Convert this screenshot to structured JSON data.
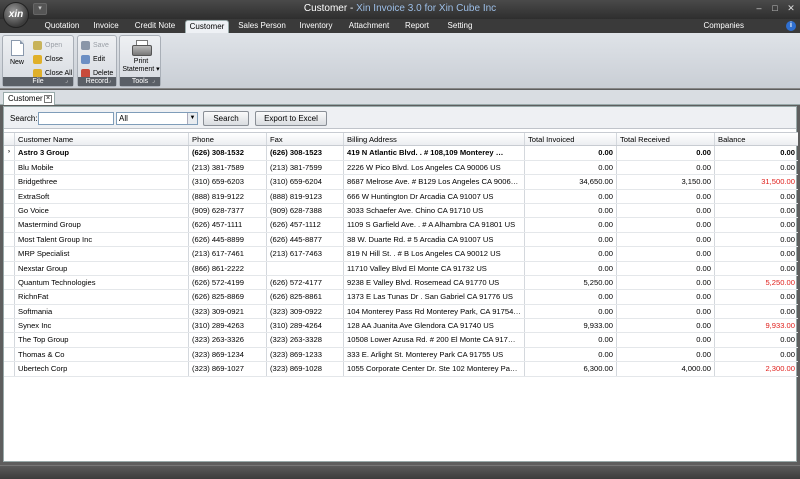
{
  "app": {
    "logo_text": "xin",
    "title_part1": "Customer - ",
    "title_part2": "Xin Invoice 3.0 for Xin Cube Inc",
    "qa_toolbar_glyph": "▾",
    "window_controls": {
      "minimize": "–",
      "maximize": "□",
      "close": "✕"
    }
  },
  "ribbon_tabs": [
    "Quotation",
    "Invoice",
    "Credit Note",
    "Customer",
    "Sales Person",
    "Inventory",
    "Attachment",
    "Report",
    "Setting"
  ],
  "active_tab": "Customer",
  "companies_label": "Companies",
  "help_icon_glyph": "i",
  "ribbon": {
    "file": {
      "label": "File",
      "new": "New",
      "open": "Open",
      "close": "Close",
      "close_all": "Close All"
    },
    "record": {
      "label": "Record",
      "save": "Save",
      "edit": "Edit",
      "delete": "Delete"
    },
    "tools": {
      "label": "Tools",
      "print_line1": "Print",
      "print_line2": "Statement ▾"
    },
    "launcher_glyph": "⌟"
  },
  "doc_tab": {
    "label": "Customer",
    "close": "×"
  },
  "search": {
    "label": "Search:",
    "value": "",
    "filter_value": "All",
    "dropdown_glyph": "▼",
    "search_button": "Search",
    "export_button": "Export to Excel"
  },
  "columns": [
    "Customer Name",
    "Phone",
    "Fax",
    "Billing Address",
    "Total Invoiced",
    "Total Received",
    "Balance"
  ],
  "rows": [
    {
      "name": "Astro 3 Group",
      "phone": "(626) 308-1532",
      "fax": "(626) 308-1523",
      "address": "419 N Atlantic Blvd. . # 108,109 Monterey …",
      "invoiced": "0.00",
      "received": "0.00",
      "balance": "0.00",
      "selected": true,
      "indicator": "›"
    },
    {
      "name": "Blu Mobile",
      "phone": "(213) 381-7589",
      "fax": "(213) 381-7599",
      "address": "2226 W Pico Blvd. Los Angeles CA 90006 US",
      "invoiced": "0.00",
      "received": "0.00",
      "balance": "0.00"
    },
    {
      "name": "Bridgethree",
      "phone": "(310) 659-6203",
      "fax": "(310) 659-6204",
      "address": "8687 Melrose Ave. # B129 Los Angeles CA 9006…",
      "invoiced": "34,650.00",
      "received": "3,150.00",
      "balance": "31,500.00",
      "highlight": true
    },
    {
      "name": "ExtraSoft",
      "phone": "(888) 819-9122",
      "fax": "(888) 819-9123",
      "address": "666 W Huntington Dr Arcadia CA 91007 US",
      "invoiced": "0.00",
      "received": "0.00",
      "balance": "0.00"
    },
    {
      "name": "Go Voice",
      "phone": "(909) 628-7377",
      "fax": "(909) 628-7388",
      "address": "3033 Schaefer Ave. Chino CA 91710 US",
      "invoiced": "0.00",
      "received": "0.00",
      "balance": "0.00"
    },
    {
      "name": "Mastermind Group",
      "phone": "(626) 457-1111",
      "fax": "(626) 457-1112",
      "address": "1109 S Garfield Ave. . # A Alhambra  CA 91801 US",
      "invoiced": "0.00",
      "received": "0.00",
      "balance": "0.00"
    },
    {
      "name": "Most Talent Group Inc",
      "phone": "(626) 445-8899",
      "fax": "(626) 445-8877",
      "address": "38 W. Duarte Rd. # 5 Arcadia  CA 91007 US",
      "invoiced": "0.00",
      "received": "0.00",
      "balance": "0.00"
    },
    {
      "name": "MRP Specialist",
      "phone": "(213) 617-7461",
      "fax": "(213) 617-7463",
      "address": "819 N Hill St. . # B Los Angeles CA 90012 US",
      "invoiced": "0.00",
      "received": "0.00",
      "balance": "0.00"
    },
    {
      "name": "Nexstar Group",
      "phone": "(866) 861-2222",
      "fax": "",
      "address": "11710 Valley Blvd El Monte  CA 91732 US",
      "invoiced": "0.00",
      "received": "0.00",
      "balance": "0.00"
    },
    {
      "name": "Quantum Technologies",
      "phone": "(626) 572-4199",
      "fax": "(626) 572-4177",
      "address": "9238 E Valley Blvd. Rosemead CA 91770 US",
      "invoiced": "5,250.00",
      "received": "0.00",
      "balance": "5,250.00",
      "highlight": true
    },
    {
      "name": "RichnFat",
      "phone": "(626) 825-8869",
      "fax": "(626) 825-8861",
      "address": "1373 E Las Tunas Dr . San Gabriel CA 91776 US",
      "invoiced": "0.00",
      "received": "0.00",
      "balance": "0.00"
    },
    {
      "name": "Softmania",
      "phone": "(323) 309-0921",
      "fax": "(323) 309-0922",
      "address": "104 Monterey Pass Rd Monterey Park, CA 91754…",
      "invoiced": "0.00",
      "received": "0.00",
      "balance": "0.00"
    },
    {
      "name": "Synex Inc",
      "phone": "(310) 289-4263",
      "fax": "(310) 289-4264",
      "address": "128 AA Juanita Ave Glendora CA 91740 US",
      "invoiced": "9,933.00",
      "received": "0.00",
      "balance": "9,933.00",
      "highlight": true
    },
    {
      "name": "The Top Group",
      "phone": "(323) 263-3326",
      "fax": "(323) 263-3328",
      "address": "10508 Lower Azusa Rd. # 200 El Monte CA 917…",
      "invoiced": "0.00",
      "received": "0.00",
      "balance": "0.00"
    },
    {
      "name": "Thomas & Co",
      "phone": "(323) 869-1234",
      "fax": "(323) 869-1233",
      "address": "333 E. Arlight St. Monterey Park CA 91755 US",
      "invoiced": "0.00",
      "received": "0.00",
      "balance": "0.00"
    },
    {
      "name": "Ubertech Corp",
      "phone": "(323) 869-1027",
      "fax": "(323) 869-1028",
      "address": "1055 Corporate Center Dr. Ste 102 Monterey Pa…",
      "invoiced": "6,300.00",
      "received": "4,000.00",
      "balance": "2,300.00",
      "highlight": true
    }
  ],
  "colors": {
    "balance_highlight": "#e0201c",
    "title_accent": "#9dbfe8"
  }
}
